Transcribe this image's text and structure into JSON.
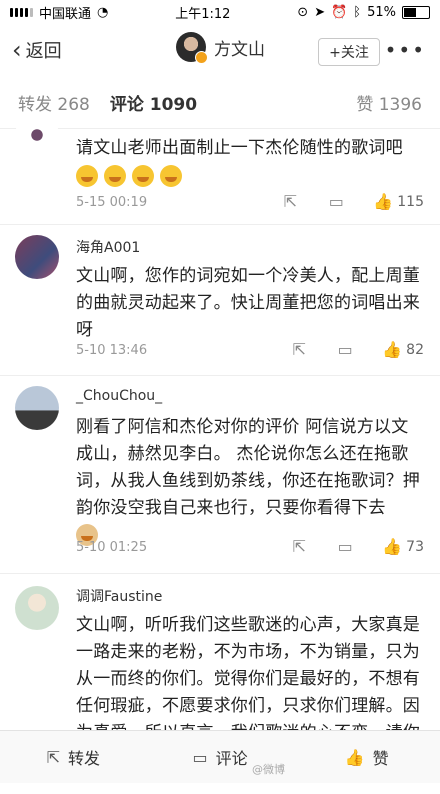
{
  "status": {
    "carrier": "中国联通",
    "time": "上午1:12",
    "battery": "51%",
    "battery_level": 0.51
  },
  "nav": {
    "back_label": "返回",
    "user_name": "方文山",
    "follow_label": "+关注",
    "more_label": "•••"
  },
  "tabs": {
    "repost": "转发 268",
    "comment": "评论 1090",
    "like": "赞 1396"
  },
  "comments": [
    {
      "name": "",
      "text": "请文山老师出面制止一下杰伦随性的歌词吧",
      "time": "5-15 00:19",
      "likes": "115"
    },
    {
      "name": "海角A001",
      "text": "文山啊，您作的词宛如一个冷美人，配上周董的曲就灵动起来了。快让周董把您的词唱出来呀",
      "time": "5-10 13:46",
      "likes": "82"
    },
    {
      "name": "_ChouChou_",
      "text": "刚看了阿信和杰伦对你的评价 阿信说方以文成山，赫然见李白。 杰伦说你怎么还在拖歌词，从我人鱼线到奶茶线，你还在拖歌词？押韵你没空我自己来也行，只要你看得下去",
      "time": "5-10 01:25",
      "likes": "73"
    },
    {
      "name": "调调Faustine",
      "text": "文山啊，听听我们这些歌迷的心声，大家真是一路走来的老粉，不为市场，不为销量，只为从一而终的你们。觉得你们是最好的，不想有任何瑕疵，不愿要求你们，只求你们理解。因为真爱，所以直言。我们歌迷的心不变，请你们做音乐的心也不变好吗",
      "time": "",
      "likes": ""
    }
  ],
  "bottom": {
    "repost": "转发",
    "comment": "评论",
    "like": "赞",
    "watermark": "@微博"
  }
}
